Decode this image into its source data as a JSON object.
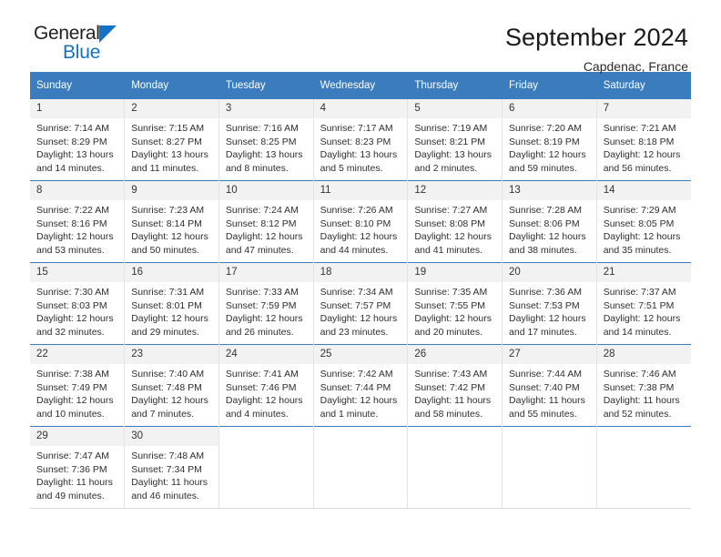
{
  "brand": {
    "name_top": "General",
    "name_bottom": "Blue",
    "triangle_color": "#1273c4"
  },
  "header": {
    "title": "September 2024",
    "subtitle": "Capdenac, France"
  },
  "theme": {
    "header_blue": "#3a7cbe",
    "daynum_bg": "#f2f2f2",
    "text": "#2d2d2d"
  },
  "weekday_headers": [
    "Sunday",
    "Monday",
    "Tuesday",
    "Wednesday",
    "Thursday",
    "Friday",
    "Saturday"
  ],
  "weeks": [
    [
      {
        "day": "1",
        "sunrise": "Sunrise: 7:14 AM",
        "sunset": "Sunset: 8:29 PM",
        "daylight1": "Daylight: 13 hours",
        "daylight2": "and 14 minutes."
      },
      {
        "day": "2",
        "sunrise": "Sunrise: 7:15 AM",
        "sunset": "Sunset: 8:27 PM",
        "daylight1": "Daylight: 13 hours",
        "daylight2": "and 11 minutes."
      },
      {
        "day": "3",
        "sunrise": "Sunrise: 7:16 AM",
        "sunset": "Sunset: 8:25 PM",
        "daylight1": "Daylight: 13 hours",
        "daylight2": "and 8 minutes."
      },
      {
        "day": "4",
        "sunrise": "Sunrise: 7:17 AM",
        "sunset": "Sunset: 8:23 PM",
        "daylight1": "Daylight: 13 hours",
        "daylight2": "and 5 minutes."
      },
      {
        "day": "5",
        "sunrise": "Sunrise: 7:19 AM",
        "sunset": "Sunset: 8:21 PM",
        "daylight1": "Daylight: 13 hours",
        "daylight2": "and 2 minutes."
      },
      {
        "day": "6",
        "sunrise": "Sunrise: 7:20 AM",
        "sunset": "Sunset: 8:19 PM",
        "daylight1": "Daylight: 12 hours",
        "daylight2": "and 59 minutes."
      },
      {
        "day": "7",
        "sunrise": "Sunrise: 7:21 AM",
        "sunset": "Sunset: 8:18 PM",
        "daylight1": "Daylight: 12 hours",
        "daylight2": "and 56 minutes."
      }
    ],
    [
      {
        "day": "8",
        "sunrise": "Sunrise: 7:22 AM",
        "sunset": "Sunset: 8:16 PM",
        "daylight1": "Daylight: 12 hours",
        "daylight2": "and 53 minutes."
      },
      {
        "day": "9",
        "sunrise": "Sunrise: 7:23 AM",
        "sunset": "Sunset: 8:14 PM",
        "daylight1": "Daylight: 12 hours",
        "daylight2": "and 50 minutes."
      },
      {
        "day": "10",
        "sunrise": "Sunrise: 7:24 AM",
        "sunset": "Sunset: 8:12 PM",
        "daylight1": "Daylight: 12 hours",
        "daylight2": "and 47 minutes."
      },
      {
        "day": "11",
        "sunrise": "Sunrise: 7:26 AM",
        "sunset": "Sunset: 8:10 PM",
        "daylight1": "Daylight: 12 hours",
        "daylight2": "and 44 minutes."
      },
      {
        "day": "12",
        "sunrise": "Sunrise: 7:27 AM",
        "sunset": "Sunset: 8:08 PM",
        "daylight1": "Daylight: 12 hours",
        "daylight2": "and 41 minutes."
      },
      {
        "day": "13",
        "sunrise": "Sunrise: 7:28 AM",
        "sunset": "Sunset: 8:06 PM",
        "daylight1": "Daylight: 12 hours",
        "daylight2": "and 38 minutes."
      },
      {
        "day": "14",
        "sunrise": "Sunrise: 7:29 AM",
        "sunset": "Sunset: 8:05 PM",
        "daylight1": "Daylight: 12 hours",
        "daylight2": "and 35 minutes."
      }
    ],
    [
      {
        "day": "15",
        "sunrise": "Sunrise: 7:30 AM",
        "sunset": "Sunset: 8:03 PM",
        "daylight1": "Daylight: 12 hours",
        "daylight2": "and 32 minutes."
      },
      {
        "day": "16",
        "sunrise": "Sunrise: 7:31 AM",
        "sunset": "Sunset: 8:01 PM",
        "daylight1": "Daylight: 12 hours",
        "daylight2": "and 29 minutes."
      },
      {
        "day": "17",
        "sunrise": "Sunrise: 7:33 AM",
        "sunset": "Sunset: 7:59 PM",
        "daylight1": "Daylight: 12 hours",
        "daylight2": "and 26 minutes."
      },
      {
        "day": "18",
        "sunrise": "Sunrise: 7:34 AM",
        "sunset": "Sunset: 7:57 PM",
        "daylight1": "Daylight: 12 hours",
        "daylight2": "and 23 minutes."
      },
      {
        "day": "19",
        "sunrise": "Sunrise: 7:35 AM",
        "sunset": "Sunset: 7:55 PM",
        "daylight1": "Daylight: 12 hours",
        "daylight2": "and 20 minutes."
      },
      {
        "day": "20",
        "sunrise": "Sunrise: 7:36 AM",
        "sunset": "Sunset: 7:53 PM",
        "daylight1": "Daylight: 12 hours",
        "daylight2": "and 17 minutes."
      },
      {
        "day": "21",
        "sunrise": "Sunrise: 7:37 AM",
        "sunset": "Sunset: 7:51 PM",
        "daylight1": "Daylight: 12 hours",
        "daylight2": "and 14 minutes."
      }
    ],
    [
      {
        "day": "22",
        "sunrise": "Sunrise: 7:38 AM",
        "sunset": "Sunset: 7:49 PM",
        "daylight1": "Daylight: 12 hours",
        "daylight2": "and 10 minutes."
      },
      {
        "day": "23",
        "sunrise": "Sunrise: 7:40 AM",
        "sunset": "Sunset: 7:48 PM",
        "daylight1": "Daylight: 12 hours",
        "daylight2": "and 7 minutes."
      },
      {
        "day": "24",
        "sunrise": "Sunrise: 7:41 AM",
        "sunset": "Sunset: 7:46 PM",
        "daylight1": "Daylight: 12 hours",
        "daylight2": "and 4 minutes."
      },
      {
        "day": "25",
        "sunrise": "Sunrise: 7:42 AM",
        "sunset": "Sunset: 7:44 PM",
        "daylight1": "Daylight: 12 hours",
        "daylight2": "and 1 minute."
      },
      {
        "day": "26",
        "sunrise": "Sunrise: 7:43 AM",
        "sunset": "Sunset: 7:42 PM",
        "daylight1": "Daylight: 11 hours",
        "daylight2": "and 58 minutes."
      },
      {
        "day": "27",
        "sunrise": "Sunrise: 7:44 AM",
        "sunset": "Sunset: 7:40 PM",
        "daylight1": "Daylight: 11 hours",
        "daylight2": "and 55 minutes."
      },
      {
        "day": "28",
        "sunrise": "Sunrise: 7:46 AM",
        "sunset": "Sunset: 7:38 PM",
        "daylight1": "Daylight: 11 hours",
        "daylight2": "and 52 minutes."
      }
    ],
    [
      {
        "day": "29",
        "sunrise": "Sunrise: 7:47 AM",
        "sunset": "Sunset: 7:36 PM",
        "daylight1": "Daylight: 11 hours",
        "daylight2": "and 49 minutes."
      },
      {
        "day": "30",
        "sunrise": "Sunrise: 7:48 AM",
        "sunset": "Sunset: 7:34 PM",
        "daylight1": "Daylight: 11 hours",
        "daylight2": "and 46 minutes."
      },
      {
        "day": "",
        "sunrise": "",
        "sunset": "",
        "daylight1": "",
        "daylight2": ""
      },
      {
        "day": "",
        "sunrise": "",
        "sunset": "",
        "daylight1": "",
        "daylight2": ""
      },
      {
        "day": "",
        "sunrise": "",
        "sunset": "",
        "daylight1": "",
        "daylight2": ""
      },
      {
        "day": "",
        "sunrise": "",
        "sunset": "",
        "daylight1": "",
        "daylight2": ""
      },
      {
        "day": "",
        "sunrise": "",
        "sunset": "",
        "daylight1": "",
        "daylight2": ""
      }
    ]
  ]
}
